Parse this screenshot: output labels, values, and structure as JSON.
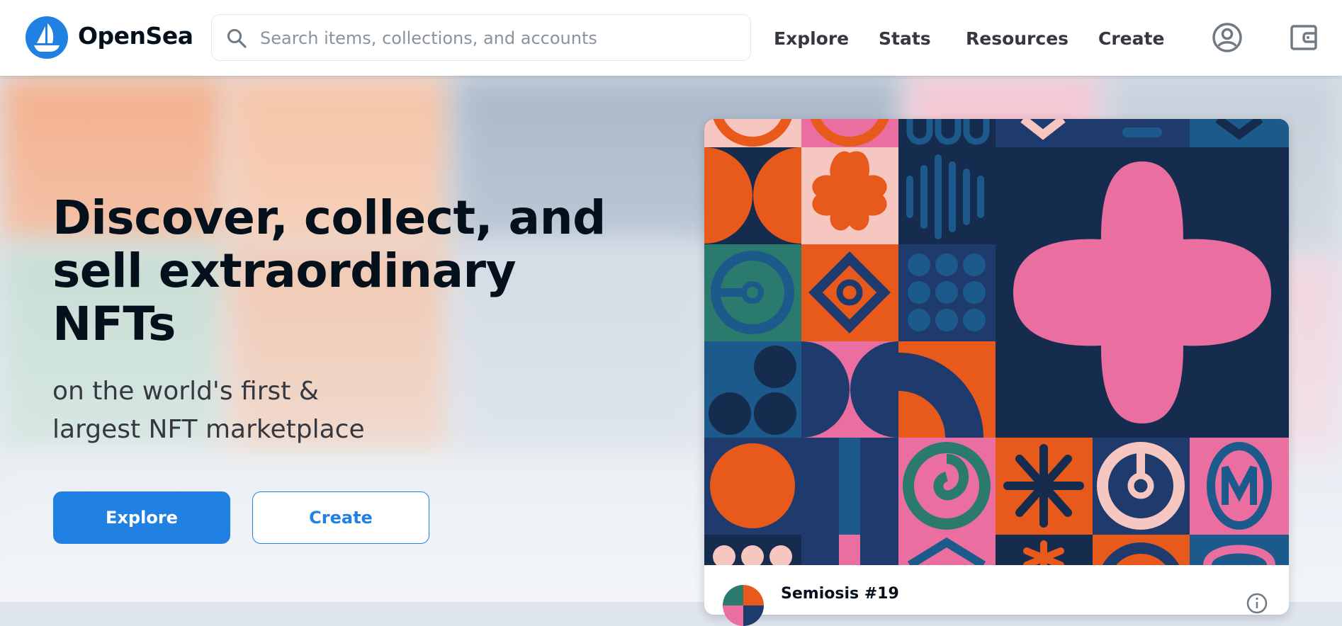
{
  "header": {
    "brand": "OpenSea",
    "search_placeholder": "Search items, collections, and accounts",
    "nav": [
      {
        "label": "Explore"
      },
      {
        "label": "Stats"
      },
      {
        "label": "Resources"
      },
      {
        "label": "Create"
      }
    ],
    "icons": {
      "logo": "opensea-logo-icon",
      "search": "search-icon",
      "account": "account-circle-icon",
      "wallet": "wallet-icon"
    }
  },
  "hero": {
    "headline": "Discover, collect, and sell extraordinary NFTs",
    "subline_1": "on the world's first &",
    "subline_2": "largest NFT marketplace",
    "explore_button": "Explore",
    "create_button": "Create"
  },
  "featured": {
    "item_name": "Semiosis #19",
    "icons": {
      "info": "info-icon"
    }
  },
  "colors": {
    "accent": "#2081e2",
    "text_primary": "#04111d",
    "text_secondary": "#353840",
    "art_orange": "#e85a1b",
    "art_navy": "#152c4e",
    "art_pink": "#ea6fa0",
    "art_blue": "#1d5a8c",
    "art_teal": "#2b7a6e",
    "art_light_pink": "#f6c6c0"
  }
}
